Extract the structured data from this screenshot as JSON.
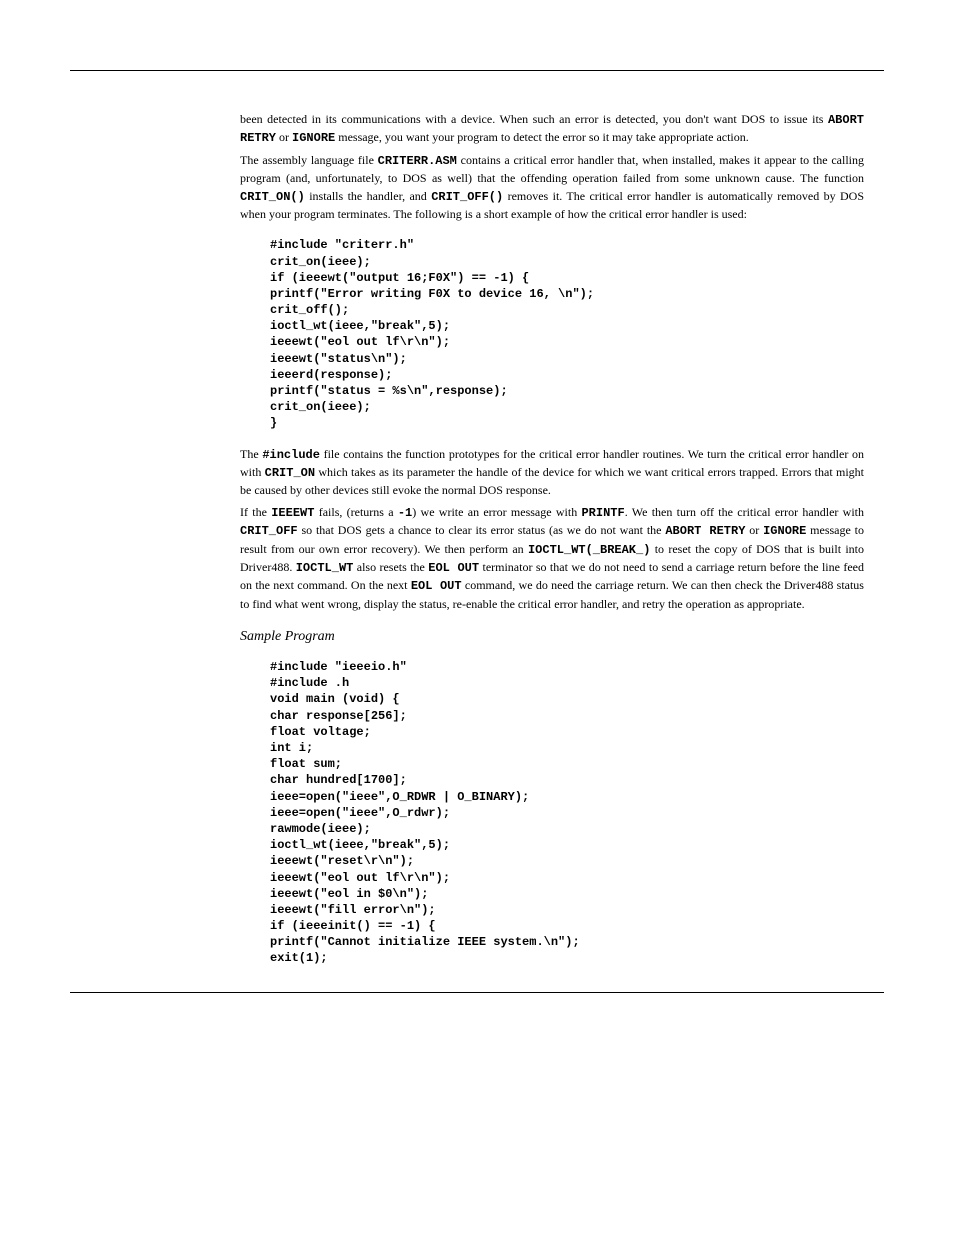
{
  "p1_a": "been detected in its communications with a device. When such an error is detected, you don't want DOS to issue its ",
  "p1_b": "ABORT RETRY",
  "p1_c": " or ",
  "p1_d": "IGNORE",
  "p1_e": " message, you want your program to detect the error so it may take appropriate action.",
  "p2_a": "The assembly language file ",
  "p2_b": "CRITERR.ASM",
  "p2_c": " contains a critical error handler that, when installed, makes it appear to the calling program (and, unfortunately, to DOS as well) that the offending operation failed from some unknown cause. The function ",
  "p2_d": "CRIT_ON()",
  "p2_e": " installs the handler, and ",
  "p2_f": "CRIT_OFF()",
  "p2_g": " removes it. The critical error handler is automatically removed by DOS when your program terminates. The following is a short example of how the critical error handler is used:",
  "code1": "#include \"criterr.h\"\ncrit_on(ieee);\nif (ieeewt(\"output 16;F0X\") == -1) {\nprintf(\"Error writing F0X to device 16, \\n\");\ncrit_off();\nioctl_wt(ieee,\"break\",5);\nieeewt(\"eol out lf\\r\\n\");\nieeewt(\"status\\n\");\nieeerd(response);\nprintf(\"status = %s\\n\",response);\ncrit_on(ieee);\n}",
  "p3_a": "The ",
  "p3_b": "#include",
  "p3_c": " file contains the function prototypes for the critical error handler routines. We turn the critical error handler on with ",
  "p3_d": "CRIT_ON",
  "p3_e": " which takes as its parameter the handle of the device for which we want critical errors trapped. Errors that might be caused by other devices still evoke the normal DOS response.",
  "p4_a": "If the ",
  "p4_b": "IEEEWT",
  "p4_c": " fails, (returns a ",
  "p4_d": "-1",
  "p4_e": ") we write an error message with ",
  "p4_f": "PRINTF",
  "p4_g": ". We then turn off the critical error handler with ",
  "p4_h": "CRIT_OFF",
  "p4_i": " so that DOS gets a chance to clear its error status (as we do not want the ",
  "p4_j": "ABORT RETRY",
  "p4_k": " or ",
  "p4_l": "IGNORE",
  "p4_m": " message to result from our own error recovery). We then perform an ",
  "p4_n": "IOCTL_WT(_BREAK_)",
  "p4_o": " to reset the copy of DOS that is built into Driver488. ",
  "p4_p": "IOCTL_WT",
  "p4_q": " also resets the ",
  "p4_r": "EOL OUT",
  "p4_s": " terminator so that we do not need to send a carriage return before the line feed on the next command. On the next ",
  "p4_t": "EOL OUT",
  "p4_u": " command, we do need the carriage return. We can then check the Driver488 status to find what went wrong, display the status, re-enable the critical error handler, and retry the operation as appropriate.",
  "h_sample": "Sample Program",
  "code2": "#include \"ieeeio.h\"\n#include .h\nvoid main (void) {\nchar response[256];\nfloat voltage;\nint i;\nfloat sum;\nchar hundred[1700];\nieee=open(\"ieee\",O_RDWR | O_BINARY);\nieee=open(\"ieee\",O_rdwr);\nrawmode(ieee);\nioctl_wt(ieee,\"break\",5);\nieeewt(\"reset\\r\\n\");\nieeewt(\"eol out lf\\r\\n\");\nieeewt(\"eol in $0\\n\");\nieeewt(\"fill error\\n\");\nif (ieeeinit() == -1) {\nprintf(\"Cannot initialize IEEE system.\\n\");\nexit(1);"
}
